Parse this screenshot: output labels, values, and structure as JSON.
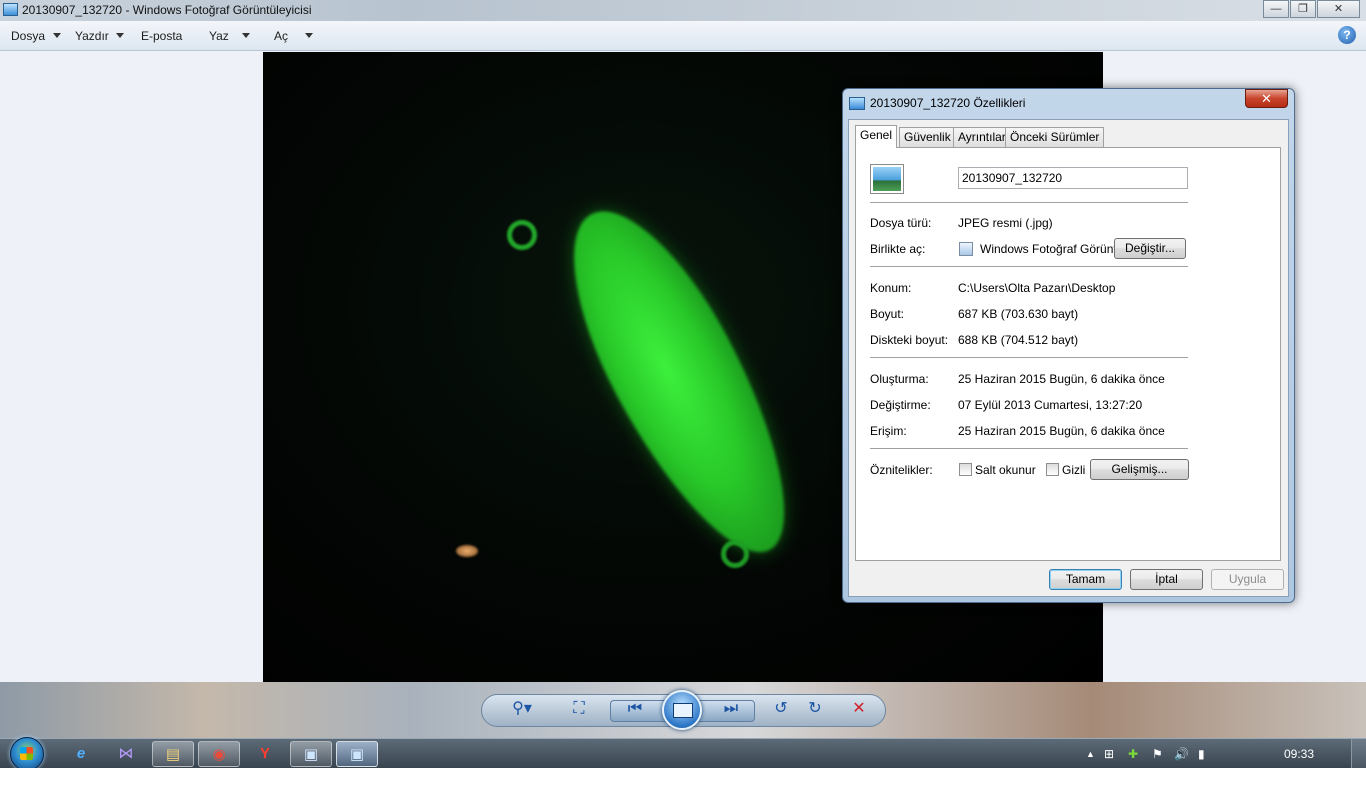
{
  "window": {
    "title": "20130907_132720 - Windows Fotoğraf Görüntüleyicisi",
    "min_symbol": "—",
    "max_symbol": "❐",
    "close_symbol": "✕"
  },
  "menu": {
    "items": [
      "Dosya",
      "Yazdır",
      "E-posta",
      "Yaz",
      "Aç"
    ],
    "help_symbol": "?"
  },
  "controls": {
    "icons": [
      "zoom-icon",
      "fit-window-icon",
      "previous-icon",
      "slideshow-icon",
      "next-icon",
      "rotate-left-icon",
      "rotate-right-icon",
      "delete-icon"
    ],
    "glyphs": {
      "zoom": "⚲▾",
      "fit": "⛶",
      "previous": "⏮",
      "next": "⏭",
      "rotate_left": "↺",
      "rotate_right": "↻",
      "delete": "✕"
    }
  },
  "dialog": {
    "title": "20130907_132720 Özellikleri",
    "close_symbol": "✕",
    "tabs": [
      "Genel",
      "Güvenlik",
      "Ayrıntılar",
      "Önceki Sürümler"
    ],
    "file_name": "20130907_132720",
    "rows": {
      "type_label": "Dosya türü:",
      "type_value": "JPEG resmi (.jpg)",
      "openwith_label": "Birlikte aç:",
      "openwith_value": "Windows Fotoğraf Görüntü",
      "change_button": "Değiştir...",
      "location_label": "Konum:",
      "location_value": "C:\\Users\\Olta Pazarı\\Desktop",
      "size_label": "Boyut:",
      "size_value": "687 KB (703.630 bayt)",
      "disksize_label": "Diskteki boyut:",
      "disksize_value": "688 KB (704.512 bayt)",
      "created_label": "Oluşturma:",
      "created_value": "25 Haziran 2015 Bugün, 6 dakika önce",
      "modified_label": "Değiştirme:",
      "modified_value": "07 Eylül 2013 Cumartesi, 13:27:20",
      "accessed_label": "Erişim:",
      "accessed_value": "25 Haziran 2015 Bugün, 6 dakika önce",
      "attributes_label": "Öznitelikler:",
      "readonly_label": "Salt okunur",
      "hidden_label": "Gizli",
      "advanced_button": "Gelişmiş..."
    },
    "buttons": {
      "ok": "Tamam",
      "cancel": "İptal",
      "apply": "Uygula"
    }
  },
  "taskbar": {
    "pinned": [
      "internet-explorer-icon",
      "visual-studio-icon",
      "file-explorer-icon",
      "chrome-icon",
      "yandex-icon",
      "photo-viewer-icon",
      "properties-window-icon"
    ],
    "glyphs": {
      "ie": "e",
      "vs": "⋈",
      "explorer": "▤",
      "chrome": "◉",
      "yandex": "Y",
      "photo": "▣",
      "props": "▣"
    },
    "tray_glyphs": {
      "show_hidden": "▲",
      "network_app": "⊞",
      "security": "✚",
      "action_center": "⚑",
      "volume": "🔊",
      "signal": "▮"
    },
    "clock": "09:33"
  }
}
